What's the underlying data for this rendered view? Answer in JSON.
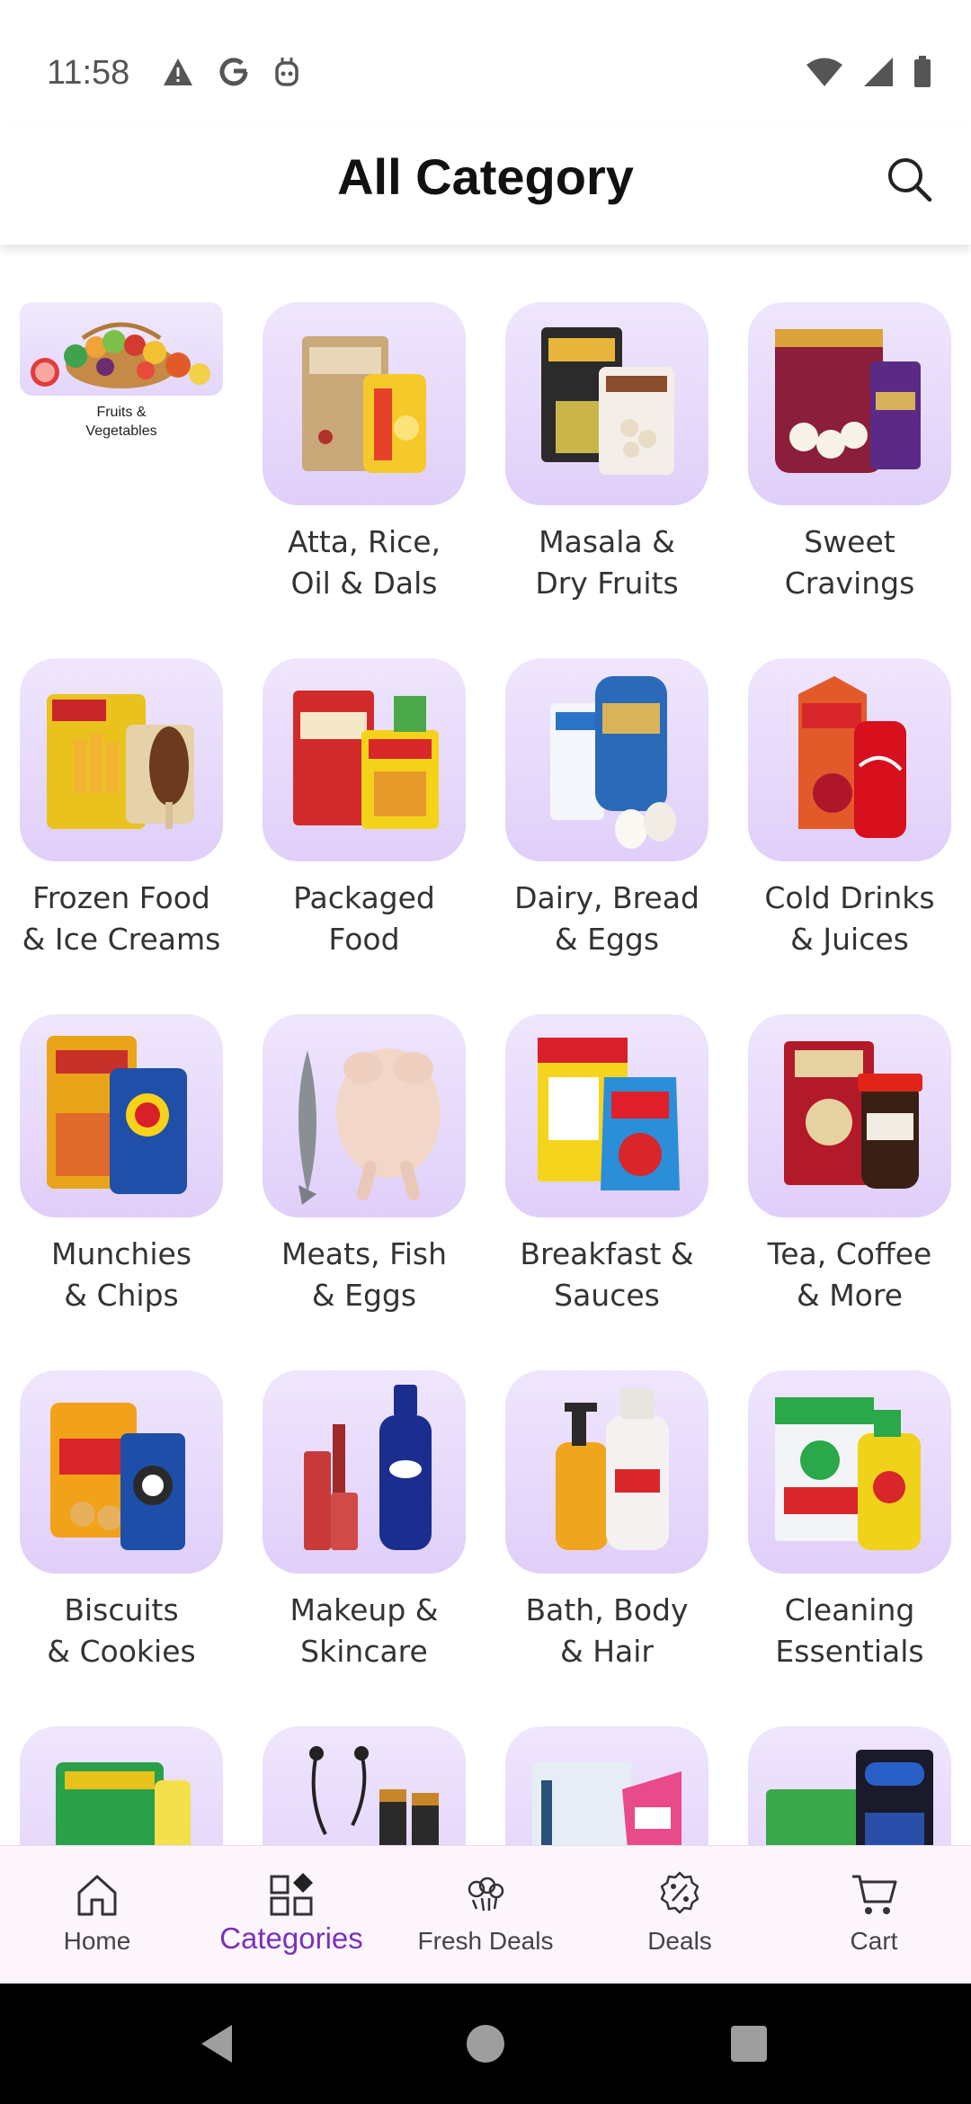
{
  "status_bar": {
    "time": "11:58",
    "left_icons": [
      "warning-icon",
      "google-icon",
      "assistant-icon"
    ],
    "right_icons": [
      "wifi-icon",
      "signal-icon",
      "battery-icon"
    ]
  },
  "header": {
    "title": "All Category",
    "search_icon": "search-icon"
  },
  "categories": [
    {
      "line1": "Fruits &",
      "line2": "Vegetables"
    },
    {
      "line1": "Atta, Rice,",
      "line2": "Oil & Dals"
    },
    {
      "line1": "Masala &",
      "line2": "Dry Fruits"
    },
    {
      "line1": "Sweet",
      "line2": "Cravings"
    },
    {
      "line1": "Frozen Food",
      "line2": "& Ice Creams"
    },
    {
      "line1": "Packaged",
      "line2": "Food"
    },
    {
      "line1": "Dairy, Bread",
      "line2": "& Eggs"
    },
    {
      "line1": "Cold Drinks",
      "line2": "& Juices"
    },
    {
      "line1": "Munchies",
      "line2": "& Chips"
    },
    {
      "line1": "Meats, Fish",
      "line2": "& Eggs"
    },
    {
      "line1": "Breakfast &",
      "line2": "Sauces"
    },
    {
      "line1": "Tea, Coffee",
      "line2": "& More"
    },
    {
      "line1": "Biscuits",
      "line2": "& Cookies"
    },
    {
      "line1": "Makeup &",
      "line2": "Skincare"
    },
    {
      "line1": "Bath, Body",
      "line2": "& Hair"
    },
    {
      "line1": "Cleaning",
      "line2": "Essentials"
    },
    {
      "line1": "",
      "line2": ""
    },
    {
      "line1": "",
      "line2": ""
    },
    {
      "line1": "",
      "line2": ""
    },
    {
      "line1": "",
      "line2": ""
    }
  ],
  "bottom_nav": {
    "active": "Categories",
    "items": [
      {
        "label": "Home",
        "icon": "home-icon"
      },
      {
        "label": "Categories",
        "icon": "categories-icon"
      },
      {
        "label": "Fresh Deals",
        "icon": "fresh-deals-icon"
      },
      {
        "label": "Deals",
        "icon": "deals-icon"
      },
      {
        "label": "Cart",
        "icon": "cart-icon"
      }
    ]
  },
  "colors": {
    "accent": "#7b2fbf",
    "tile_bg": "#e6d8fb"
  }
}
